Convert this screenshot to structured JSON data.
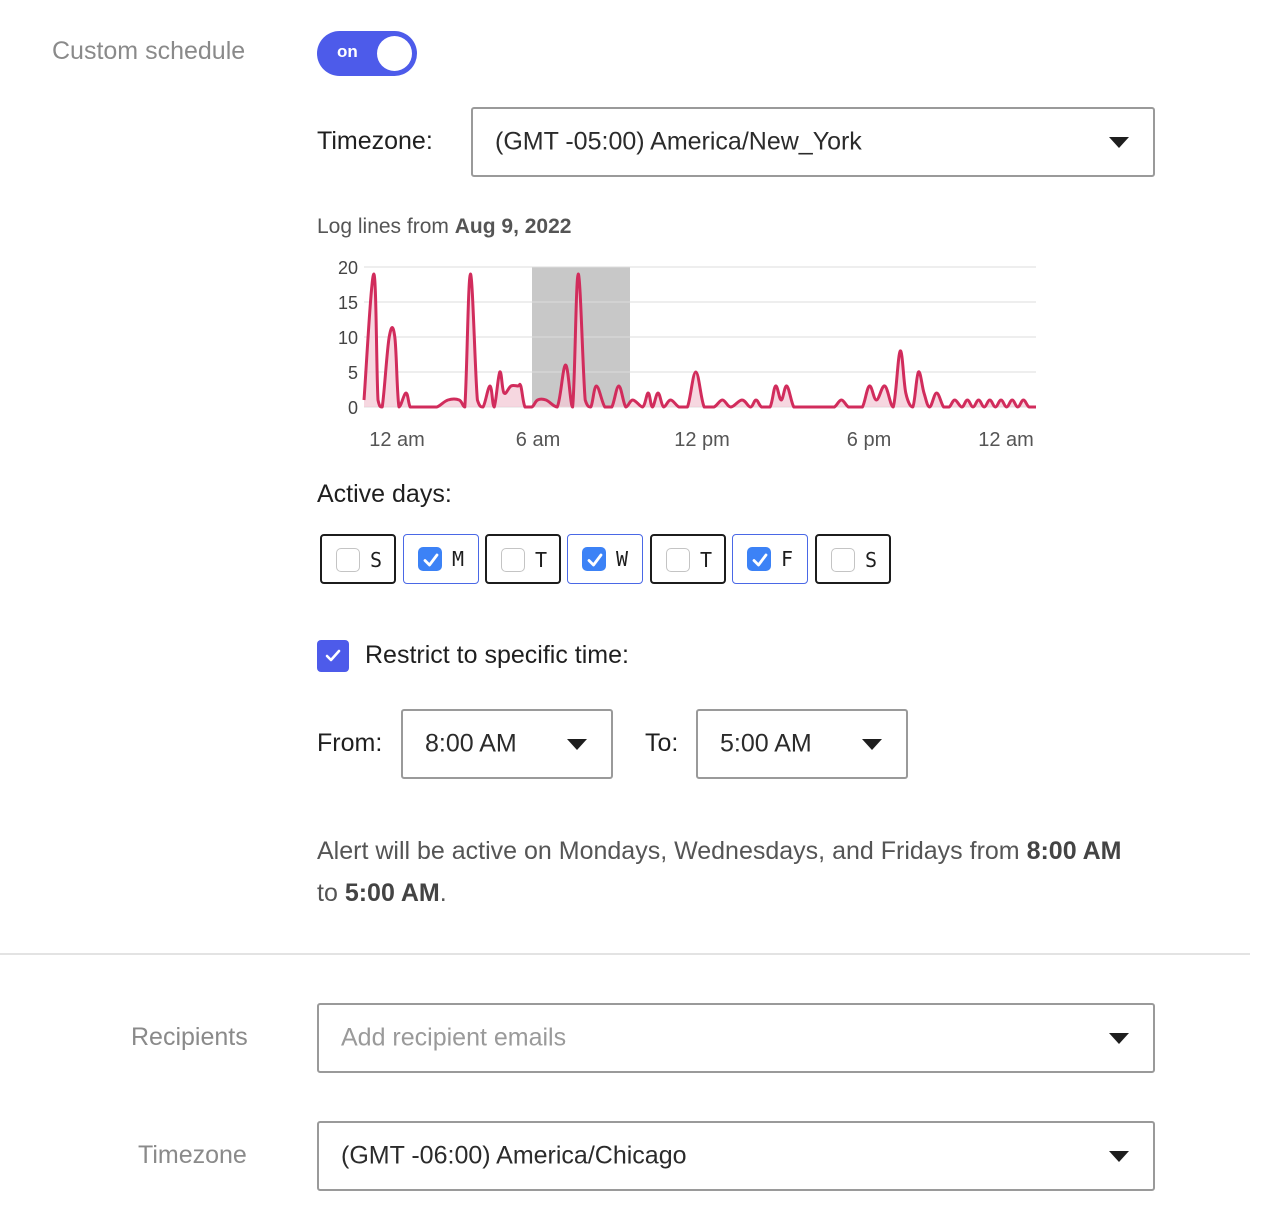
{
  "schedule": {
    "label": "Custom schedule",
    "toggle_text": "on",
    "timezone_label": "Timezone:",
    "timezone_value": "(GMT -05:00) America/New_York"
  },
  "chart": {
    "caption_prefix": "Log lines from",
    "caption_date": "Aug 9, 2022"
  },
  "chart_data": {
    "type": "area",
    "title": "",
    "xlabel": "",
    "ylabel": "",
    "ylim": [
      0,
      20
    ],
    "y_ticks": [
      "0",
      "5",
      "10",
      "15",
      "20"
    ],
    "x_ticks": [
      "12 am",
      "6 am",
      "12 pm",
      "6 pm",
      "12 am"
    ],
    "grid": true,
    "highlight_range_hours": [
      6,
      9.5
    ],
    "series": [
      {
        "color": "#d12c5c",
        "x_hours": [
          0,
          0.35,
          0.5,
          0.65,
          0.9,
          1.1,
          1.25,
          1.5,
          1.65,
          1.85,
          2.05,
          2.3,
          2.6,
          3,
          3.4,
          3.6,
          3.8,
          4.05,
          4.25,
          4.5,
          4.65,
          4.85,
          5.0,
          5.25,
          5.5,
          5.6,
          5.75,
          6.0,
          6.2,
          6.5,
          6.9,
          7.2,
          7.45,
          7.65,
          7.9,
          8.1,
          8.3,
          8.6,
          8.85,
          9.1,
          9.35,
          9.6,
          9.95,
          10.15,
          10.3,
          10.5,
          10.7,
          10.95,
          11.25,
          11.55,
          11.85,
          12.15,
          12.5,
          12.8,
          13.1,
          13.5,
          13.8,
          14.0,
          14.2,
          14.5,
          14.7,
          14.9,
          15.1,
          15.35,
          15.6,
          15.8,
          16.05,
          16.3,
          16.55,
          16.8,
          17.05,
          17.3,
          17.55,
          17.8,
          18.05,
          18.3,
          18.6,
          18.9,
          19.15,
          19.35,
          19.6,
          19.8,
          20.0,
          20.2,
          20.45,
          20.7,
          20.9,
          21.1,
          21.35,
          21.55,
          21.75,
          21.95,
          22.15,
          22.35,
          22.55,
          22.75,
          22.95,
          23.15,
          23.35,
          23.55,
          23.75,
          24.0
        ],
        "values": [
          1,
          19,
          1,
          0,
          10,
          10,
          0,
          2,
          0,
          0,
          0,
          0,
          0,
          1,
          1,
          0,
          19,
          1,
          0,
          3,
          0,
          5,
          2,
          3,
          3,
          3,
          0,
          0,
          1,
          1,
          0,
          6,
          0,
          19,
          1,
          0,
          3,
          0,
          0,
          3,
          0,
          1,
          0,
          2,
          0,
          2,
          0,
          1,
          0,
          0,
          5,
          0,
          0,
          1,
          0,
          1,
          0,
          1,
          0,
          0,
          3,
          1,
          3,
          0,
          0,
          0,
          0,
          0,
          0,
          0,
          1,
          0,
          0,
          0,
          3,
          1,
          3,
          0,
          8,
          2,
          0,
          5,
          2,
          0,
          2,
          0,
          0,
          1,
          0,
          1,
          0,
          1,
          0,
          1,
          0,
          1,
          0,
          1,
          0,
          1,
          0,
          0
        ],
        "x_range_hours": [
          0,
          24
        ]
      }
    ]
  },
  "active_days": {
    "label": "Active days:",
    "days": [
      {
        "letter": "S",
        "checked": false
      },
      {
        "letter": "M",
        "checked": true
      },
      {
        "letter": "T",
        "checked": false
      },
      {
        "letter": "W",
        "checked": true
      },
      {
        "letter": "T",
        "checked": false
      },
      {
        "letter": "F",
        "checked": true
      },
      {
        "letter": "S",
        "checked": false
      }
    ]
  },
  "restrict": {
    "label": "Restrict to specific time:",
    "checked": true,
    "from_label": "From:",
    "from_value": "8:00 AM",
    "to_label": "To:",
    "to_value": "5:00 AM"
  },
  "summary": {
    "prefix": "Alert will be active on Mondays, Wednesdays, and Fridays from",
    "from": "8:00 AM",
    "mid": "to",
    "to": "5:00 AM",
    "suffix": "."
  },
  "recipients": {
    "label": "Recipients",
    "placeholder": "Add recipient emails"
  },
  "notify_timezone": {
    "label": "Timezone",
    "value": "(GMT -06:00) America/Chicago"
  },
  "colors": {
    "accent": "#4d5bea",
    "checkbox": "#3c82f6",
    "series": "#d12c5c",
    "series_fill": "#f3c9d5",
    "highlight": "#c8c8c8"
  }
}
